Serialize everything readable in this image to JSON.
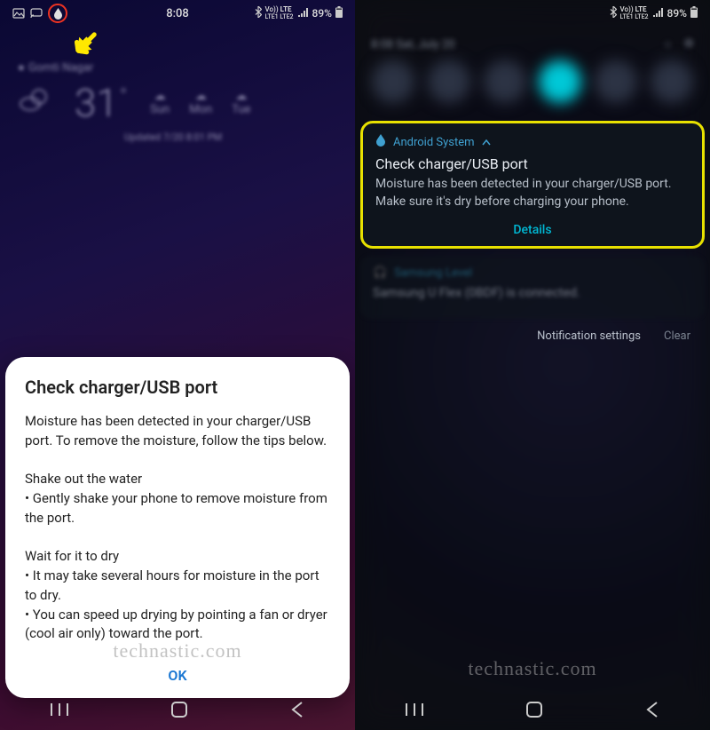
{
  "left": {
    "statusbar": {
      "time": "8:08",
      "signal": "Vo)) LTE",
      "battery": "89%",
      "moisture_icon": "moisture-drop-icon"
    },
    "weather": {
      "location": "Gomti Nagar",
      "temp": "31",
      "degree": "°",
      "days": [
        "Sun",
        "Mon",
        "Tue"
      ],
      "updated": "Updated 7/20 8:01 PM"
    },
    "dialog": {
      "title": "Check charger/USB port",
      "body": "Moisture has been detected in your charger/USB port. To remove the moisture, follow the tips below.\n\nShake out the water\n • Gently shake your phone to remove moisture from the port.\n\nWait for it to dry\n • It may take several hours for moisture in the port to dry.\n • You can speed up drying by pointing a fan or dryer (cool air only) toward the port.",
      "ok": "OK"
    }
  },
  "right": {
    "statusbar": {
      "signal": "Vo)) LTE",
      "battery": "89%"
    },
    "shade_header": {
      "datetime": "8:08  Sat, July 20"
    },
    "notification": {
      "app": "Android System",
      "title": "Check charger/USB port",
      "body": "Moisture has been detected in your charger/USB port. Make sure it's dry before charging your phone.",
      "action": "Details"
    },
    "notification2": {
      "app": "Samsung Level",
      "body": "Samsung U Flex (0BDF) is connected."
    },
    "footer": {
      "settings": "Notification settings",
      "clear": "Clear"
    }
  },
  "watermark": "technastic.com",
  "colors": {
    "accent_cyan": "#00b8d4",
    "highlight_yellow": "#e8e100",
    "danger_red": "#e32",
    "link_blue": "#1976d2"
  }
}
